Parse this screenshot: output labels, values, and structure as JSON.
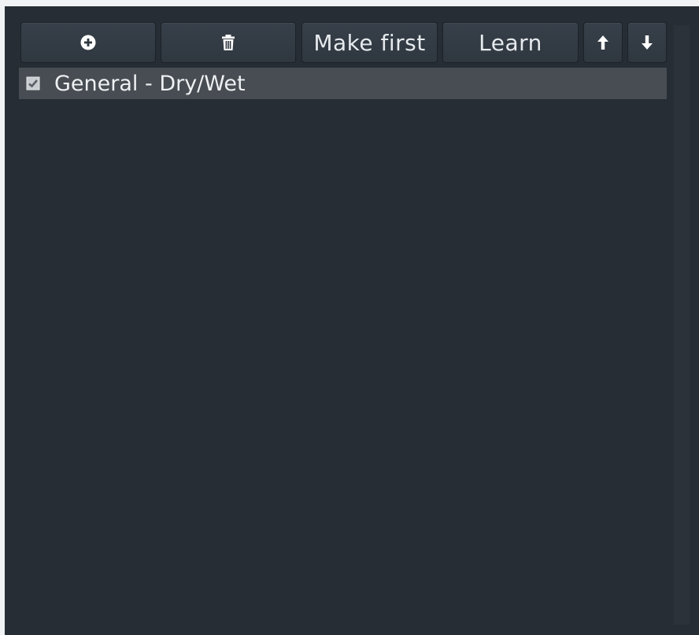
{
  "toolbar": {
    "add_icon": "plus-circle-icon",
    "delete_icon": "trash-icon",
    "make_first_label": "Make first",
    "learn_label": "Learn",
    "up_icon": "arrow-up-icon",
    "down_icon": "arrow-down-icon"
  },
  "list": {
    "items": [
      {
        "label": "General - Dry/Wet",
        "checked": true
      }
    ]
  },
  "colors": {
    "background": "#262d34",
    "button": "#333b43",
    "selected_row": "#474d53",
    "text": "#e6eaed"
  }
}
